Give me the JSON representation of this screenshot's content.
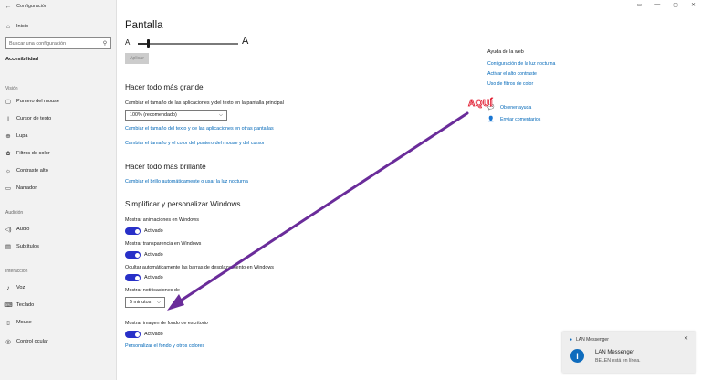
{
  "window": {
    "title": "Configuración",
    "back_glyph": "←",
    "controls": [
      "▭",
      "—",
      "▢",
      "✕"
    ]
  },
  "sidebar": {
    "home": "Inicio",
    "search_placeholder": "Buscar una configuración",
    "category": "Accesibilidad",
    "sections": {
      "vision": "Visión",
      "audicion": "Audición",
      "interaccion": "Interacción"
    },
    "vision_items": [
      {
        "label": "Puntero del mouse",
        "icon": "mouse-pointer-icon"
      },
      {
        "label": "Cursor de texto",
        "icon": "text-cursor-icon"
      },
      {
        "label": "Lupa",
        "icon": "magnifier-icon"
      },
      {
        "label": "Filtros de color",
        "icon": "color-filter-icon"
      },
      {
        "label": "Contraste alto",
        "icon": "high-contrast-icon"
      },
      {
        "label": "Narrador",
        "icon": "narrator-icon"
      }
    ],
    "audicion_items": [
      {
        "label": "Audio",
        "icon": "speaker-icon"
      },
      {
        "label": "Subtítulos",
        "icon": "subtitles-icon"
      }
    ],
    "interaccion_items": [
      {
        "label": "Voz",
        "icon": "microphone-icon"
      },
      {
        "label": "Teclado",
        "icon": "keyboard-icon"
      },
      {
        "label": "Mouse",
        "icon": "mouse-icon"
      },
      {
        "label": "Control ocular",
        "icon": "eye-control-icon"
      }
    ]
  },
  "main": {
    "page_title": "Pantalla",
    "slider": {
      "left_label": "A",
      "right_label": "A",
      "value_fraction": 0.1
    },
    "apply_button": "Aplicar",
    "section_bigger": {
      "title": "Hacer todo más grande",
      "scale_label": "Cambiar el tamaño de las aplicaciones y del texto en la pantalla principal",
      "scale_value": "100% (recomendado)",
      "link1": "Cambiar el tamaño del texto y de las aplicaciones en otras pantallas",
      "link2": "Cambiar el tamaño y el color del puntero del mouse y del cursor"
    },
    "section_brighter": {
      "title": "Hacer todo más brillante",
      "link": "Cambiar el brillo automáticamente o usar la luz nocturna"
    },
    "section_simplify": {
      "title": "Simplificar y personalizar Windows",
      "animations_label": "Mostrar animaciones en Windows",
      "transparency_label": "Mostrar transparencia en Windows",
      "scrollbars_label": "Ocultar automáticamente las barras de desplazamiento en Windows",
      "toggle_on": "Activado",
      "notifications_label": "Mostrar notificaciones de",
      "notifications_value": "5 minutos",
      "background_label": "Mostrar imagen de fondo de escritorio",
      "personalize_link": "Personalizar el fondo y otros colores"
    }
  },
  "right_panel": {
    "title": "Ayuda de la web",
    "links": [
      "Configuración de la luz nocturna",
      "Activar el alto contraste",
      "Uso de filtros de color"
    ],
    "get_help": "Obtener ayuda",
    "feedback": "Enviar comentarios"
  },
  "annotation": {
    "text": "AQUÍ",
    "color": "#e0162b",
    "arrow_color": "#6a2c9a"
  },
  "notification": {
    "app": "LAN Messenger",
    "title": "LAN Messenger",
    "body": "BELEN está en línea.",
    "icon_glyph": "i",
    "close_glyph": "✕"
  },
  "colors": {
    "accent": "#2830c8",
    "link": "#0067b8",
    "sidebar_bg": "#f2f2f2"
  }
}
